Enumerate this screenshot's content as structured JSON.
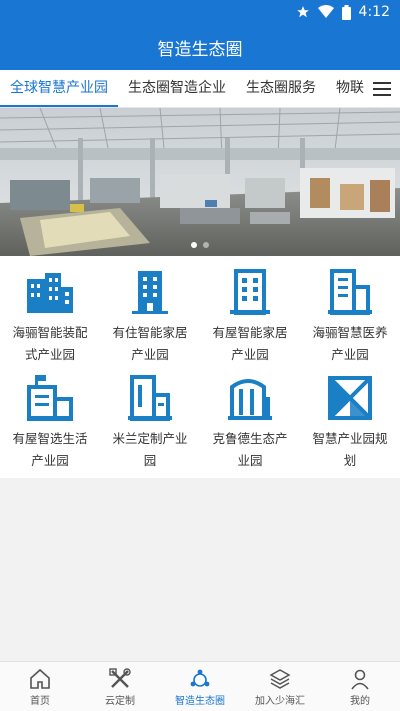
{
  "status_bar": {
    "time": "4:12",
    "icons": [
      "star-icon",
      "wifi-icon",
      "battery-icon"
    ]
  },
  "app_bar": {
    "title": "智造生态圈"
  },
  "tabs": [
    {
      "label": "全球智慧产业园",
      "active": true
    },
    {
      "label": "生态圈智造企业",
      "active": false
    },
    {
      "label": "生态圈服务",
      "active": false
    },
    {
      "label": "物联",
      "active": false
    }
  ],
  "tab_menu_icon": "menu-icon",
  "banner": {
    "image": "factory-workshop-photo",
    "slide_count": 2,
    "active_slide": 1
  },
  "parks": [
    {
      "label": "海骊智能装配式产业园",
      "icon": "buildings-icon"
    },
    {
      "label": "有住智能家居产业园",
      "icon": "tower-icon"
    },
    {
      "label": "有屋智能家居产业园",
      "icon": "office-building-icon"
    },
    {
      "label": "海骊智慧医养产业园",
      "icon": "hospital-building-icon"
    },
    {
      "label": "有屋智选生活产业园",
      "icon": "flag-building-icon"
    },
    {
      "label": "米兰定制产业园",
      "icon": "apartment-icon"
    },
    {
      "label": "克鲁德生态产业园",
      "icon": "arched-building-icon"
    },
    {
      "label": "智慧产业园规划",
      "icon": "blueprint-icon"
    }
  ],
  "bottom_nav": [
    {
      "label": "首页",
      "icon": "home-icon",
      "active": false
    },
    {
      "label": "云定制",
      "icon": "tools-icon",
      "active": false
    },
    {
      "label": "智造生态圈",
      "icon": "ecosystem-icon",
      "active": true
    },
    {
      "label": "加入少海汇",
      "icon": "layers-icon",
      "active": false
    },
    {
      "label": "我的",
      "icon": "user-icon",
      "active": false
    }
  ],
  "colors": {
    "primary": "#1976d2",
    "icon_blue": "#1a7fc4",
    "text": "#333333"
  }
}
